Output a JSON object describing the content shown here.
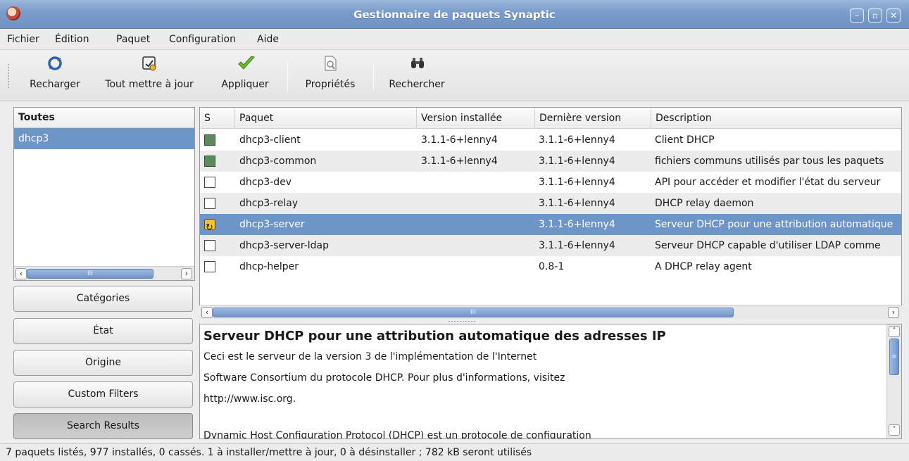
{
  "window": {
    "title": "Gestionnaire de paquets Synaptic"
  },
  "menubar": {
    "items": [
      {
        "label": "Fichier"
      },
      {
        "label": "Édition"
      },
      {
        "label": "Paquet"
      },
      {
        "label": "Configuration"
      },
      {
        "label": "Aide"
      }
    ]
  },
  "toolbar": {
    "reload": {
      "label": "Recharger",
      "icon": "reload-icon"
    },
    "upgrade_all": {
      "label": "Tout mettre à jour",
      "icon": "upgrade-all-icon"
    },
    "apply": {
      "label": "Appliquer",
      "icon": "apply-checkmark-icon"
    },
    "properties": {
      "label": "Propriétés",
      "icon": "properties-icon"
    },
    "search": {
      "label": "Rechercher",
      "icon": "binoculars-icon"
    }
  },
  "left_panel": {
    "header": "Toutes",
    "items": [
      "dhcp3"
    ],
    "selected_index": 0,
    "buttons": {
      "categories": "Catégories",
      "state": "État",
      "origin": "Origine",
      "custom_filters": "Custom Filters",
      "search_results": "Search Results"
    }
  },
  "table": {
    "columns": {
      "status": "S",
      "package": "Paquet",
      "installed": "Version installée",
      "latest": "Dernière version",
      "description": "Description"
    },
    "rows": [
      {
        "status": "installed",
        "package": "dhcp3-client",
        "installed": "3.1.1-6+lenny4",
        "latest": "3.1.1-6+lenny4",
        "description": "Client DHCP"
      },
      {
        "status": "installed",
        "package": "dhcp3-common",
        "installed": "3.1.1-6+lenny4",
        "latest": "3.1.1-6+lenny4",
        "description": "fichiers communs utilisés par tous les paquets"
      },
      {
        "status": "not-installed",
        "package": "dhcp3-dev",
        "installed": "",
        "latest": "3.1.1-6+lenny4",
        "description": "API pour accéder et modifier l'état du serveur"
      },
      {
        "status": "not-installed",
        "package": "dhcp3-relay",
        "installed": "",
        "latest": "3.1.1-6+lenny4",
        "description": "DHCP relay daemon"
      },
      {
        "status": "marked-install",
        "package": "dhcp3-server",
        "installed": "",
        "latest": "3.1.1-6+lenny4",
        "description": "Serveur DHCP pour une attribution automatique"
      },
      {
        "status": "not-installed",
        "package": "dhcp3-server-ldap",
        "installed": "",
        "latest": "3.1.1-6+lenny4",
        "description": "Serveur DHCP capable d'utiliser LDAP comme"
      },
      {
        "status": "not-installed",
        "package": "dhcp-helper",
        "installed": "",
        "latest": "0.8-1",
        "description": "A DHCP relay agent"
      }
    ],
    "selected_index": 4
  },
  "description": {
    "title": "Serveur DHCP pour une attribution automatique des adresses IP",
    "lines": [
      "Ceci est le serveur de la version 3 de l'implémentation de l'Internet",
      "Software Consortium du protocole DHCP. Pour plus d'informations, visitez",
      "http://www.isc.org."
    ],
    "cut_line": "Dynamic Host Configuration Protocol (DHCP) est un protocole de configuration"
  },
  "statusbar": {
    "text": "7 paquets listés, 977 installés, 0 cassés. 1 à installer/mettre à jour, 0 à désinstaller ; 782 kB seront utilisés"
  },
  "colors": {
    "selection": "#6e95c8",
    "installed_box": "#5c8a5a",
    "titlebar": "#7a9ccb"
  }
}
